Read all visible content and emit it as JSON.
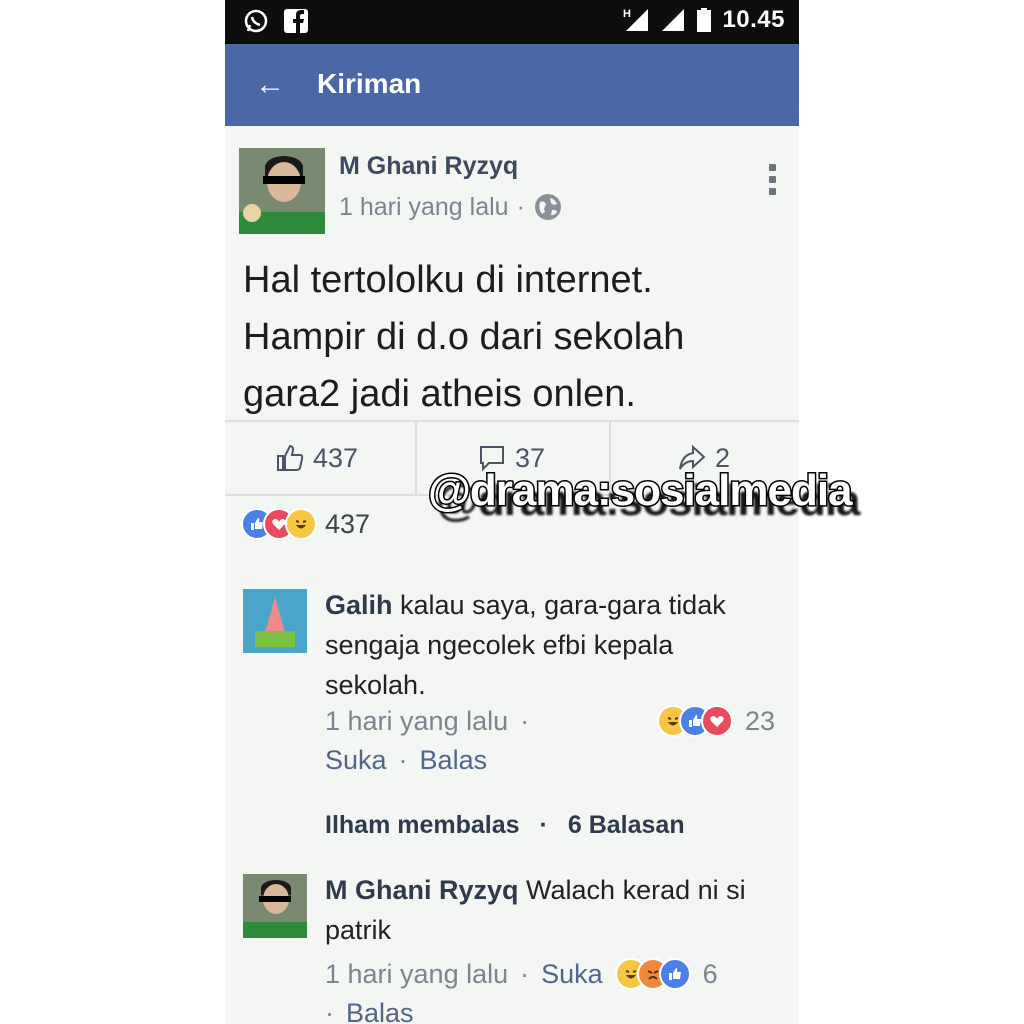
{
  "status_bar": {
    "time": "10.45",
    "network": "H"
  },
  "app_bar": {
    "title": "Kiriman",
    "back_icon": "arrow-left-icon"
  },
  "post": {
    "author": "M Ghani Ryzyq",
    "time": "1 hari yang lalu",
    "separator": "·",
    "text": "Hal tertololku di internet. Hampir di d.o dari sekolah gara2 jadi atheis onlen.",
    "likes": "437",
    "comments": "37",
    "shares": "2",
    "reaction_total": "437"
  },
  "comments": [
    {
      "author": "Galih",
      "text": "kalau saya, gara-gara tidak sengaja ngecolek efbi kepala sekolah.",
      "time": "1 hari yang lalu",
      "reaction_count": "23",
      "like_label": "Suka",
      "reply_label": "Balas",
      "replies_summary": {
        "who": "Ilham membalas",
        "count": "6 Balasan"
      }
    },
    {
      "author": "M Ghani Ryzyq",
      "text": "Walach kerad ni si patrik",
      "time": "1 hari yang lalu",
      "like_label": "Suka",
      "reaction_count": "6",
      "reply_label": "Balas"
    }
  ],
  "watermark": "@drama:sosialmedia",
  "colors": {
    "appbar": "#4a67a8",
    "link": "#51668c",
    "like_blue": "#4d7fe8",
    "love_red": "#e84a5f",
    "haha_yellow": "#f6c644"
  }
}
